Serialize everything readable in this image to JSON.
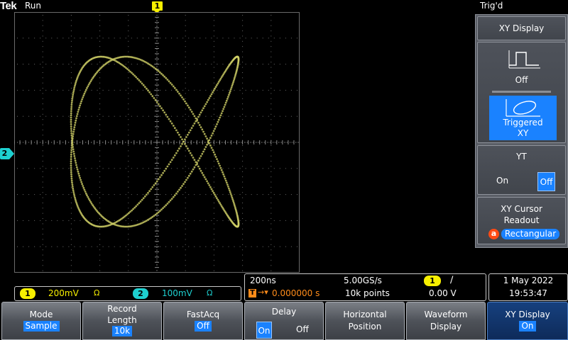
{
  "status": {
    "brand": "Tek",
    "run_state": "Run",
    "trigger_state": "Trig'd"
  },
  "markers": {
    "ch1_trigger_pos": "1",
    "ch2_ground": "2"
  },
  "channels": {
    "ch1": {
      "number": "1",
      "scale": "200mV",
      "impedance_symbol": "Ω",
      "color": "#f7ef00"
    },
    "ch2": {
      "number": "2",
      "scale": "100mV",
      "impedance_symbol": "Ω",
      "color": "#1ed0d0"
    }
  },
  "horizontal": {
    "time_per_div": "200ns",
    "sample_rate": "5.00GS/s",
    "delay_readout": "0.000000 s",
    "record_points": "10k points"
  },
  "trigger": {
    "source": "1",
    "slope_symbol": "∕",
    "level": "0.00 V"
  },
  "datetime": {
    "date": "1 May 2022",
    "time": "19:53:47"
  },
  "side_menu": {
    "title": "XY Display",
    "off_label": "Off",
    "triggered_label_line1": "Triggered",
    "triggered_label_line2": "XY",
    "yt_title": "YT",
    "yt_on": "On",
    "yt_off": "Off",
    "cursor_title_line1": "XY Cursor",
    "cursor_title_line2": "Readout",
    "cursor_badge": "a",
    "cursor_value": "Rectangular"
  },
  "softkeys": [
    {
      "label": "Mode",
      "value": "Sample"
    },
    {
      "label": "Record\nLength",
      "value": "10k"
    },
    {
      "label": "FastAcq",
      "value": "Off"
    },
    {
      "label": "Delay",
      "on": "On",
      "off": "Off"
    },
    {
      "label": "Horizontal\nPosition"
    },
    {
      "label": "Waveform\nDisplay"
    },
    {
      "label": "XY Display",
      "value": "On"
    }
  ],
  "colors": {
    "trace": "#cfcf66",
    "accent_blue": "#1a82ff",
    "ch1": "#f7ef00",
    "ch2": "#1ed0d0",
    "grid": "#6a6a6a"
  }
}
